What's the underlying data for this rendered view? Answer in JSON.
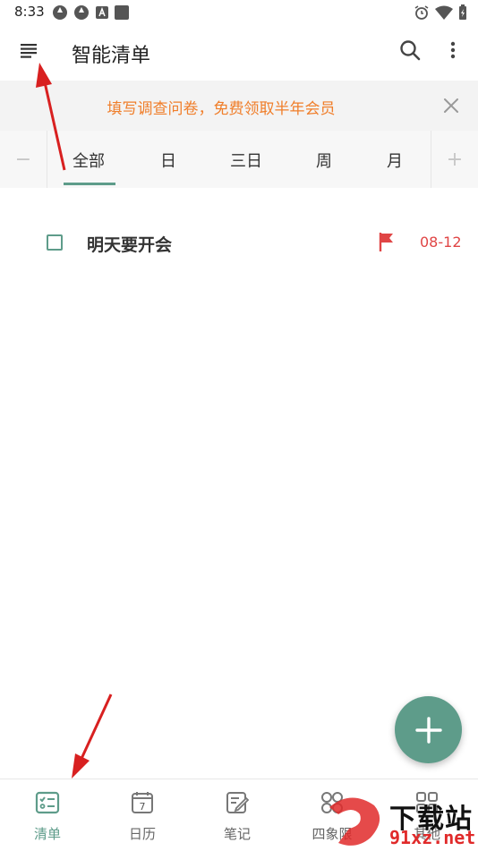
{
  "status_bar": {
    "time": "8:33"
  },
  "app_bar": {
    "title": "智能清单"
  },
  "banner": {
    "text": "填写调查问卷，免费领取半年会员",
    "text_color": "#f07e2a"
  },
  "range_tabs": {
    "minus": "−",
    "plus": "+",
    "items": [
      "全部",
      "日",
      "三日",
      "周",
      "月"
    ],
    "selected": "全部",
    "accent_color": "#5e9c8a"
  },
  "tasks": [
    {
      "title": "明天要开会",
      "flag_color": "#e04545",
      "date": "08-12"
    }
  ],
  "bottom_nav": {
    "items": [
      {
        "label": "清单",
        "icon": "checklist-icon",
        "active": true
      },
      {
        "label": "日历",
        "icon": "calendar-icon",
        "calendar_day": "7"
      },
      {
        "label": "笔记",
        "icon": "note-edit-icon"
      },
      {
        "label": "四象限",
        "icon": "quadrant-icon"
      },
      {
        "label": "其他",
        "icon": "more-grid-icon"
      }
    ]
  },
  "watermark": {
    "text": "下载站",
    "url": "91xz.net"
  }
}
